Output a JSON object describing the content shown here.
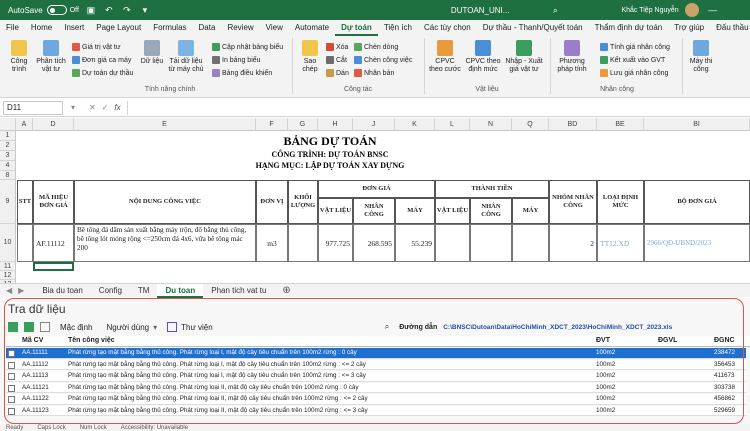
{
  "titlebar": {
    "autosave": "AutoSave",
    "autosave_state": "Off",
    "filename": "DUTOAN_UNI...",
    "user": "Khắc Tiệp Nguyễn"
  },
  "ribbon_tabs": [
    "File",
    "Home",
    "Insert",
    "Page Layout",
    "Formulas",
    "Data",
    "Review",
    "View",
    "Automate",
    "Dự toán",
    "Tiện ích",
    "Các tùy chọn",
    "Dự thầu - Thanh/Quyết toán",
    "Thẩm định dự toán",
    "Trợ giúp",
    "Đấu thầu qua mạng"
  ],
  "active_tab": "Dự toán",
  "ribbon": {
    "cong_trinh": "Công trình",
    "phan_tich": "Phân tích vật tư",
    "gia_tri_vat_tu": "Giá trị vật tư",
    "don_gia_ca_may": "Đơn giá ca máy",
    "du_toan_du_thau": "Dự toán dự thầu",
    "du_lieu": "Dữ liệu",
    "tai_du_lieu": "Tải dữ liệu từ máy chủ",
    "cap_nhat": "Cập nhật bảng biểu",
    "in_bang_bieu": "In bảng biểu",
    "bang_dieu_khien": "Bảng điều khiển",
    "group_tinh_nang": "Tính năng chính",
    "sao_chep": "Sao chép",
    "xoa": "Xóa",
    "cat": "Cắt",
    "dan": "Dán",
    "chen_dong": "Chèn dòng",
    "chen_cong_viec": "Chèn công việc",
    "nhan_ban": "Nhân bản",
    "group_cong_tac": "Công tác",
    "cpvc_theo_cuoc": "CPVC theo cước",
    "cpvc_theo_dinh_muc": "CPVC theo định mức",
    "nhap_xuat": "Nhập - Xuất giá vật tư",
    "group_vat_lieu": "Vật liệu",
    "phuong_phap_tinh": "Phương pháp tính",
    "tinh_gia_nc": "Tính giá nhân công",
    "ket_xuat": "Kết xuất vào GVT",
    "luu_gia_nc": "Lưu giá nhân công",
    "group_nhan_cong": "Nhân công",
    "may_thi_cong": "Máy thi công"
  },
  "formula_bar": {
    "namebox": "D11",
    "fx": "fx"
  },
  "columns": [
    "A",
    "D",
    "E",
    "F",
    "G",
    "H",
    "J",
    "K",
    "L",
    "N",
    "Q",
    "BD",
    "BE",
    "BI"
  ],
  "sheet": {
    "title": "BẢNG DỰ TOÁN",
    "cong_trinh": "CÔNG TRÌNH: DỰ TOÁN BNSC",
    "hang_muc": "HẠNG MỤC: LẬP DỰ TOÁN XAY DỰNG",
    "headers": {
      "stt": "STT",
      "ma_hieu": "MÃ HIỆU ĐƠN GIÁ",
      "noi_dung": "NỘI DUNG CÔNG VIỆC",
      "don_vi": "ĐƠN VỊ",
      "khoi_luong": "KHỐI LƯỢNG",
      "don_gia": "ĐƠN GIÁ",
      "thanh_tien": "THÀNH TIỀN",
      "vat_lieu": "VẬT LIỆU",
      "nhan_cong": "NHÂN CÔNG",
      "may": "MÁY",
      "nhom_nhan_cong": "NHÓM NHÂN CÔNG",
      "loai_dinh_muc": "LOẠI ĐỊNH MỨC",
      "bo_don_gia": "BỘ ĐƠN GIÁ"
    },
    "row": {
      "ma_hieu": "AF.11112",
      "noi_dung": "Bê tông đá dăm sản xuất bằng máy trộn, đổ bằng thủ công, bê tông lót móng rộng <=250cm đá 4x6, vữa bê tông mác 200",
      "don_vi": "m3",
      "vat_lieu": "977.725",
      "nhan_cong": "268.595",
      "may": "55.239",
      "nhom_nhan_cong": "2",
      "loai_dinh_muc": "TT12.XD",
      "bo_don_gia": "2966/QĐ-UBND/2023"
    },
    "row_numbers": [
      "1",
      "2",
      "3",
      "4",
      "8",
      "9",
      "10",
      "11",
      "12",
      "13"
    ]
  },
  "sheet_tabs": [
    "Bia du toan",
    "Config",
    "TM",
    "Du toan",
    "Phan tich vat tu"
  ],
  "active_sheet": "Du toan",
  "panel": {
    "title": "Tra dữ liệu",
    "mac_dinh": "Mặc định",
    "nguoi_dung": "Người dùng",
    "thu_vien": "Thư viện",
    "duong_dan_label": "Đường dẫn",
    "duong_dan": "C:\\BNSC\\Dutoan\\Data\\HoChiMinh_XDCT_2023\\HoChiMinh_XDCT_2023.xls",
    "col_ma": "Mã CV",
    "col_ten": "Tên công việc",
    "col_dvt": "ĐVT",
    "col_dgvl": "ĐGVL",
    "col_dgnc": "ĐGNC",
    "rows": [
      {
        "ma": "AA.11111",
        "ten": "Phát rừng tạo mặt bằng bằng thủ công. Phát rừng loại I, mật độ cây tiêu chuẩn trên 100m2 rừng : 0 cây",
        "dvt": "100m2",
        "dgvl": "",
        "dgnc": "238472"
      },
      {
        "ma": "AA.11112",
        "ten": "Phát rừng tạo mặt bằng bằng thủ công. Phát rừng loại I, mật độ cây tiêu chuẩn trên 100m2 rừng : <= 2 cây",
        "dvt": "100m2",
        "dgvl": "",
        "dgnc": "356453"
      },
      {
        "ma": "AA.11113",
        "ten": "Phát rừng tạo mặt bằng bằng thủ công. Phát rừng loại I, mật độ cây tiêu chuẩn trên 100m2 rừng : <= 3 cây",
        "dvt": "100m2",
        "dgvl": "",
        "dgnc": "411673"
      },
      {
        "ma": "AA.11121",
        "ten": "Phát rừng tạo mặt bằng bằng thủ công. Phát rừng loại II, mật độ cây tiêu chuẩn trên 100m2 rừng : 0 cây",
        "dvt": "100m2",
        "dgvl": "",
        "dgnc": "303738"
      },
      {
        "ma": "AA.11122",
        "ten": "Phát rừng tạo mặt bằng bằng thủ công. Phát rừng loại II, mật độ cây tiêu chuẩn trên 100m2 rừng : <= 2 cây",
        "dvt": "100m2",
        "dgvl": "",
        "dgnc": "456862"
      },
      {
        "ma": "AA.11123",
        "ten": "Phát rừng tạo mặt bằng bằng thủ công. Phát rừng loại II, mật độ cây tiêu chuẩn trên 100m2 rừng : <= 3 cây",
        "dvt": "100m2",
        "dgvl": "",
        "dgnc": "529659"
      }
    ]
  },
  "statusbar": {
    "ready": "Ready",
    "caps": "Caps Lock",
    "num": "Num Lock",
    "access": "Accessibility: Unavailable"
  },
  "colors": {
    "excel_green": "#1e6f41",
    "selection_blue": "#1f6fd0",
    "highlight_red": "#d9534f"
  }
}
